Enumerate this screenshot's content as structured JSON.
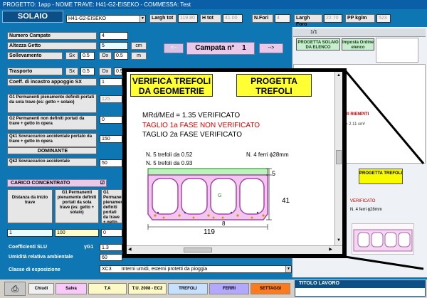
{
  "window": {
    "title": "PROGETTO: 1app - NOME TRAVE: H41-G2-EISEKO - COMMESSA: Test"
  },
  "header": {
    "solaio_label": "SOLAIO",
    "beam_select": "H41-G2-EISEKO",
    "largh_tot_label": "Largh tot",
    "largh_tot_value": "119.80",
    "h_tot_label": "H tot",
    "h_tot_value": "41.00",
    "n_fori_label": "N.Fori",
    "n_fori_value": "4",
    "largh_foro_label": "Largh Foro",
    "largh_foro_value": "22.70",
    "pp_label": "PP kg/m",
    "pp_value": "523"
  },
  "form": {
    "numero_campate_label": "Numero Campate",
    "numero_campate_value": "4",
    "altezza_getto_label": "Altezza Getto",
    "altezza_getto_value": "5",
    "altezza_getto_unit": "cm",
    "sollevamento_label": "Sollevamento",
    "sx_label": "Sx",
    "sx_value": "0.5",
    "dx_label": "Dx",
    "dx_value": "0.5",
    "m_unit": "m",
    "trasporto_label": "Trasporto",
    "trasp_sx_value": "0.5",
    "trasp_dx_value": "0.5",
    "coeff_label": "Coeff. di incastro appoggio SX",
    "coeff_value": "1",
    "g1_label": "G1 Permanenti pienamente definiti portati da sola trave (es: getto + solaio)",
    "g1_value": "125",
    "g2_label": "G2 Permanenti non definiti portati da trave + getto in opera",
    "g2_value": "0",
    "qk1_label": "Qk1 Sovraccarico accidentale portato da trave + getto in opera",
    "qk1_value": "150",
    "dominante_label": "DOMINANTE",
    "qk2_label": "Qk2 Sovraccarico accidentale",
    "qk2_value": "50",
    "carico_label": "CARICO CONCENTRATO",
    "carico_checkbox": "☑",
    "distanza_label": "Distanza da inizio trave",
    "g1c_label": "G1 Permanenti pienamente definiti portati da sola trave (es: getto + solaio)",
    "g1_short_label": "G1 Permanenti pienamente definiti portati da trave + getto (es: getto + solaio)",
    "distanza_value": "1",
    "g1c_value": "100",
    "g1c2_value": "0",
    "coeff_slu_label": "Coefficienti SLU",
    "gamma_g1_label": "γG1",
    "gamma_g1_value": "1.3",
    "umidita_label": "Umidità relativa ambientale",
    "umidita_value": "60",
    "classe_label": "Classe di esposizione",
    "classe_value": "XC3",
    "classe_desc": "Interni umidi, esterni protetti da pioggia"
  },
  "nav": {
    "prev": "<--",
    "campata": "Campata n°",
    "campata_num": "1",
    "next": "-->"
  },
  "right_panel": {
    "progetta_elenco": "PROGETTA SOLAIO DA ELENCO",
    "imposta_ordine": "Imposta Ordine elenco",
    "pager": "1/1",
    "riempiti_text": "ORI RIEMPITI",
    "area_text": "a = 2.11 cm²",
    "progetta_trefoli_small": "PROGETTA TREFOLI",
    "verificato_text": "VERIFICATO",
    "ferri_text": "N. 4 ferri ϕ28mm"
  },
  "overlay": {
    "verifica_btn": "VERIFICA TREFOLI DA GEOMETRIE",
    "progetta_btn": "PROGETTA TREFOLI",
    "line1": "MRd/MEd = 1.35 VERIFICATO",
    "line2": "TAGLIO 1a FASE NON VERIFICATO",
    "line3": "TAGLIO 2a FASE VERIFICATO",
    "trefoli1": "N. 5 trefoli da 0.52",
    "trefoli2": "N. 5 trefoli da 0.93",
    "ferri": "N. 4 ferri ϕ28mm",
    "dim_height": "41",
    "dim_width": "119",
    "dim_top": "5",
    "dim_eight": "8",
    "g_label": "G"
  },
  "toolbar": {
    "chiudi": "Chiudi",
    "salva": "Salva",
    "ta": "T.A",
    "tu": "T.U. 2008 - EC2",
    "trefoli": "TREFOLI",
    "ferri": "FERRI",
    "settaggi": "SETTAGGI",
    "titolo_lavoro": "TITOLO LAVORO"
  }
}
